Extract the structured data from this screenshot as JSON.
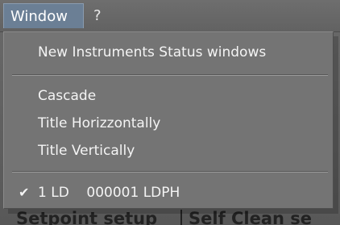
{
  "menubar": {
    "items": [
      {
        "label": "Window"
      },
      {
        "label": "?"
      }
    ]
  },
  "window_menu": {
    "items": [
      {
        "label": "New Instruments Status windows"
      },
      {
        "label": "Cascade"
      },
      {
        "label": "Title Horizzontally"
      },
      {
        "label": "Title Vertically"
      },
      {
        "label": "1 LD    000001 LDPH",
        "checked": true,
        "check_symbol": "✔"
      }
    ]
  },
  "background": {
    "links": [
      {
        "label": "Setpoint setup"
      },
      {
        "label": "Self Clean se"
      }
    ]
  }
}
